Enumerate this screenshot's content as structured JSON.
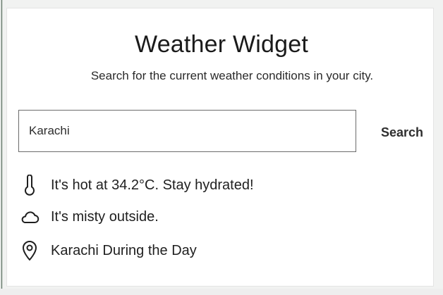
{
  "widget": {
    "title": "Weather Widget",
    "subtitle": "Search for the current weather conditions in your city."
  },
  "search": {
    "value": "Karachi",
    "placeholder": "",
    "button_label": "Search"
  },
  "results": {
    "temperature": {
      "icon": "thermometer-icon",
      "text": "It's hot at 34.2°C. Stay hydrated!"
    },
    "condition": {
      "icon": "cloud-icon",
      "text": "It's misty outside."
    },
    "location": {
      "icon": "location-pin-icon",
      "text": "Karachi During the Day"
    }
  }
}
